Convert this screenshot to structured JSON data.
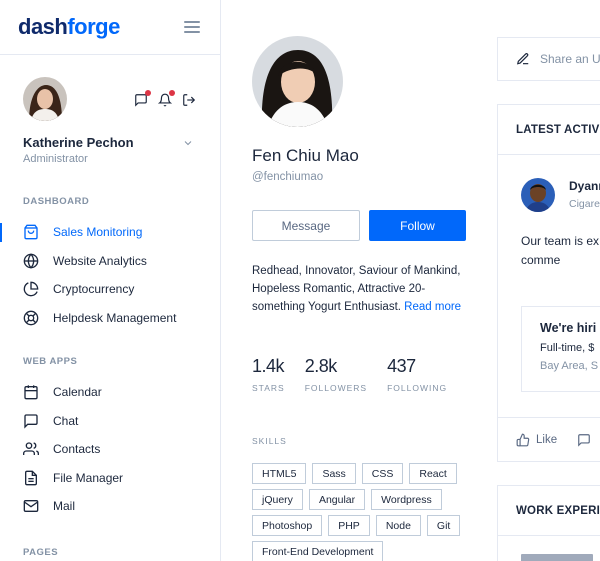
{
  "brand": {
    "part1": "dash",
    "part2": "forge"
  },
  "user": {
    "name": "Katherine Pechon",
    "role": "Administrator"
  },
  "nav": {
    "dashboard_label": "DASHBOARD",
    "dashboard_items": [
      {
        "label": "Sales Monitoring",
        "icon": "shopping-bag-icon",
        "active": true
      },
      {
        "label": "Website Analytics",
        "icon": "globe-icon"
      },
      {
        "label": "Cryptocurrency",
        "icon": "pie-chart-icon"
      },
      {
        "label": "Helpdesk Management",
        "icon": "life-buoy-icon"
      }
    ],
    "webapps_label": "WEB APPS",
    "webapps_items": [
      {
        "label": "Calendar",
        "icon": "calendar-icon"
      },
      {
        "label": "Chat",
        "icon": "message-square-icon"
      },
      {
        "label": "Contacts",
        "icon": "users-icon"
      },
      {
        "label": "File Manager",
        "icon": "file-text-icon"
      },
      {
        "label": "Mail",
        "icon": "mail-icon"
      }
    ],
    "pages_label": "PAGES"
  },
  "profile": {
    "name": "Fen Chiu Mao",
    "handle": "@fenchiumao",
    "message_label": "Message",
    "follow_label": "Follow",
    "bio": "Redhead, Innovator, Saviour of Mankind, Hopeless Romantic, Attractive 20-something Yogurt Enthusiast.",
    "read_more": "Read more",
    "stats": [
      {
        "value": "1.4k",
        "label": "STARS"
      },
      {
        "value": "2.8k",
        "label": "FOLLOWERS"
      },
      {
        "value": "437",
        "label": "FOLLOWING"
      }
    ],
    "skills_label": "SKILLS",
    "skills": [
      "HTML5",
      "Sass",
      "CSS",
      "React",
      "jQuery",
      "Angular",
      "Wordpress",
      "Photoshop",
      "PHP",
      "Node",
      "Git",
      "Front-End Development"
    ]
  },
  "feed": {
    "share_placeholder": "Share an U",
    "activity_title": "LATEST ACTIV",
    "post_author": "Dyann",
    "post_sub": "Cigare",
    "post_text": "Our team is ex Engineer to dr drop a comme",
    "job_title": "We're hiri",
    "job_type": "Full-time, $",
    "job_location": "Bay Area, S",
    "like_label": "Like",
    "work_title": "WORK EXPERI"
  },
  "colors": {
    "accent": "#0168fa",
    "text": "#1c273c",
    "muted": "#8392a5",
    "border": "#e5e9f2",
    "alert": "#dc3545"
  }
}
